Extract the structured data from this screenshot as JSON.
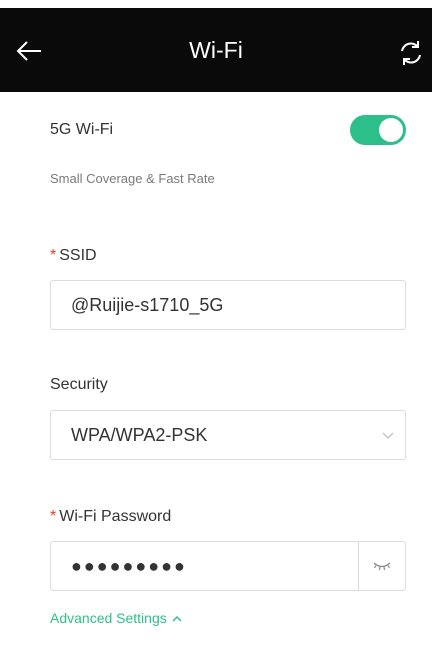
{
  "header": {
    "title": "Wi-Fi",
    "back_icon": "arrow-left-icon",
    "refresh_icon": "refresh-icon",
    "background": "#0a0a0a"
  },
  "wifi5g": {
    "label": "5G Wi-Fi",
    "subtitle": "Small Coverage & Fast Rate",
    "enabled": true,
    "toggle_color": "#2dbf8a"
  },
  "ssid": {
    "required_mark": "*",
    "label": "SSID",
    "value": "@Ruijie-s1710_5G"
  },
  "security": {
    "label": "Security",
    "value": "WPA/WPA2-PSK",
    "dropdown_icon": "chevron-down-icon"
  },
  "password": {
    "required_mark": "*",
    "label": "Wi-Fi Password",
    "masked_value": "●●●●●●●●●",
    "visibility_icon": "eye-closed-icon"
  },
  "advanced": {
    "label": "Advanced Settings",
    "icon": "chevron-up-icon",
    "color": "#2dbf8a"
  }
}
